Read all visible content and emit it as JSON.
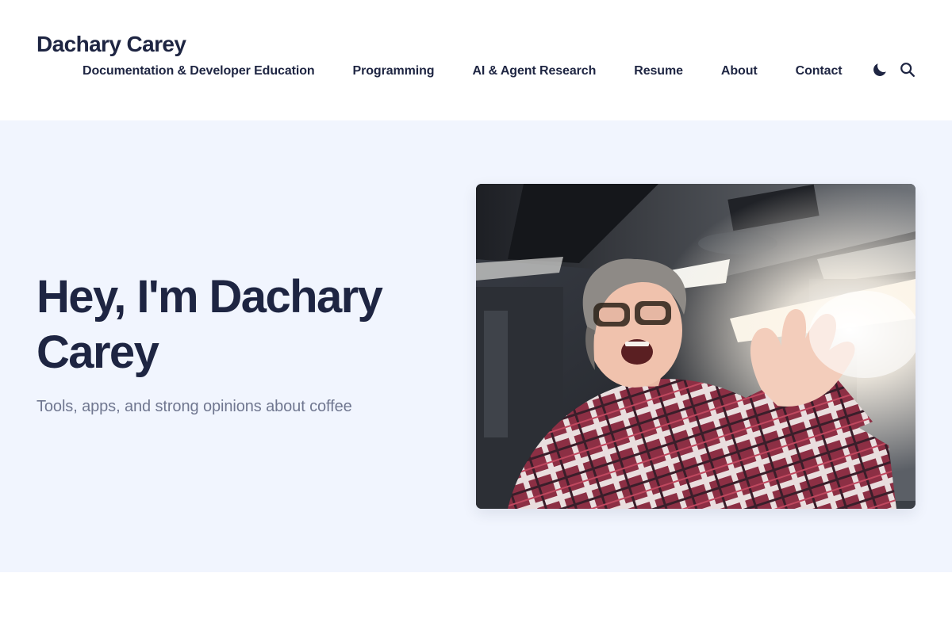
{
  "header": {
    "site_title": "Dachary Carey",
    "nav": [
      {
        "label": "Documentation & Developer Education"
      },
      {
        "label": "Programming"
      },
      {
        "label": "AI & Agent Research"
      },
      {
        "label": "Resume"
      },
      {
        "label": "About"
      },
      {
        "label": "Contact"
      }
    ],
    "icons": {
      "theme": "moon-icon",
      "search": "search-icon"
    }
  },
  "hero": {
    "title": "Hey, I'm Dachary Carey",
    "subtitle": "Tools, apps, and strong opinions about coffee"
  },
  "colors": {
    "text": "#1e2542",
    "muted": "#707790",
    "hero_bg": "#f1f5fe",
    "header_bg": "#ffffff"
  }
}
